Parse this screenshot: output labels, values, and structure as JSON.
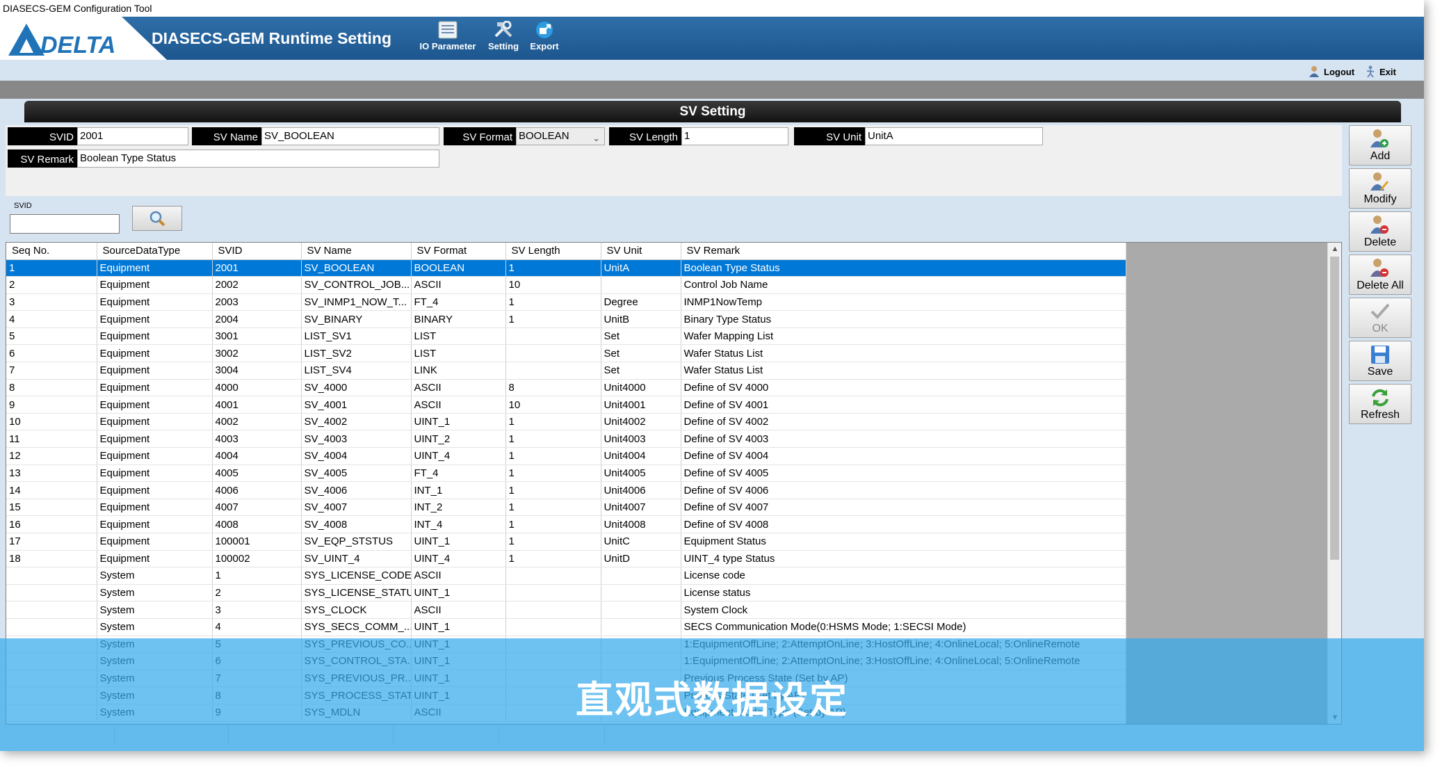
{
  "window": {
    "title": "DIASECS-GEM Configuration Tool"
  },
  "header": {
    "app_title": "DIASECS-GEM Runtime Setting",
    "logo_text": "DELTA",
    "toolbar": [
      {
        "label": "IO Parameter",
        "icon": "io-parameter-icon"
      },
      {
        "label": "Setting",
        "icon": "setting-tools-icon"
      },
      {
        "label": "Export",
        "icon": "export-icon"
      }
    ]
  },
  "top_actions": {
    "logout": "Logout",
    "exit": "Exit"
  },
  "section_title": "SV Setting",
  "form": {
    "svid": {
      "label": "SVID",
      "value": "2001"
    },
    "sv_name": {
      "label": "SV Name",
      "value": "SV_BOOLEAN"
    },
    "sv_format": {
      "label": "SV Format",
      "value": "BOOLEAN"
    },
    "sv_length": {
      "label": "SV Length",
      "value": "1"
    },
    "sv_unit": {
      "label": "SV Unit",
      "value": "UnitA"
    },
    "sv_remark": {
      "label": "SV Remark",
      "value": "Boolean Type Status"
    }
  },
  "search": {
    "label": "SVID",
    "value": ""
  },
  "table": {
    "columns": [
      "Seq No.",
      "SourceDataType",
      "SVID",
      "SV Name",
      "SV Format",
      "SV Length",
      "SV Unit",
      "SV Remark"
    ],
    "selected_row": 0,
    "rows": [
      [
        "1",
        "Equipment",
        "2001",
        "SV_BOOLEAN",
        "BOOLEAN",
        "1",
        "UnitA",
        "Boolean Type Status"
      ],
      [
        "2",
        "Equipment",
        "2002",
        "SV_CONTROL_JOB...",
        "ASCII",
        "10",
        "",
        "Control Job Name"
      ],
      [
        "3",
        "Equipment",
        "2003",
        "SV_INMP1_NOW_T...",
        "FT_4",
        "1",
        "Degree",
        "INMP1NowTemp"
      ],
      [
        "4",
        "Equipment",
        "2004",
        "SV_BINARY",
        "BINARY",
        "1",
        "UnitB",
        "Binary Type Status"
      ],
      [
        "5",
        "Equipment",
        "3001",
        "LIST_SV1",
        "LIST",
        "",
        "Set",
        "Wafer Mapping List"
      ],
      [
        "6",
        "Equipment",
        "3002",
        "LIST_SV2",
        "LIST",
        "",
        "Set",
        "Wafer Status List"
      ],
      [
        "7",
        "Equipment",
        "3004",
        "LIST_SV4",
        "LINK",
        "",
        "Set",
        "Wafer Status List"
      ],
      [
        "8",
        "Equipment",
        "4000",
        "SV_4000",
        "ASCII",
        "8",
        "Unit4000",
        "Define of SV 4000"
      ],
      [
        "9",
        "Equipment",
        "4001",
        "SV_4001",
        "ASCII",
        "10",
        "Unit4001",
        "Define of SV 4001"
      ],
      [
        "10",
        "Equipment",
        "4002",
        "SV_4002",
        "UINT_1",
        "1",
        "Unit4002",
        "Define of SV 4002"
      ],
      [
        "11",
        "Equipment",
        "4003",
        "SV_4003",
        "UINT_2",
        "1",
        "Unit4003",
        "Define of SV 4003"
      ],
      [
        "12",
        "Equipment",
        "4004",
        "SV_4004",
        "UINT_4",
        "1",
        "Unit4004",
        "Define of SV 4004"
      ],
      [
        "13",
        "Equipment",
        "4005",
        "SV_4005",
        "FT_4",
        "1",
        "Unit4005",
        "Define of SV 4005"
      ],
      [
        "14",
        "Equipment",
        "4006",
        "SV_4006",
        "INT_1",
        "1",
        "Unit4006",
        "Define of SV 4006"
      ],
      [
        "15",
        "Equipment",
        "4007",
        "SV_4007",
        "INT_2",
        "1",
        "Unit4007",
        "Define of SV 4007"
      ],
      [
        "16",
        "Equipment",
        "4008",
        "SV_4008",
        "INT_4",
        "1",
        "Unit4008",
        "Define of SV 4008"
      ],
      [
        "17",
        "Equipment",
        "100001",
        "SV_EQP_STSTUS",
        "UINT_1",
        "1",
        "UnitC",
        "Equipment Status"
      ],
      [
        "18",
        "Equipment",
        "100002",
        "SV_UINT_4",
        "UINT_4",
        "1",
        "UnitD",
        "UINT_4 type Status"
      ],
      [
        "",
        "System",
        "1",
        "SYS_LICENSE_CODE",
        "ASCII",
        "",
        "",
        "License code"
      ],
      [
        "",
        "System",
        "2",
        "SYS_LICENSE_STATUS",
        "UINT_1",
        "",
        "",
        "License status"
      ],
      [
        "",
        "System",
        "3",
        "SYS_CLOCK",
        "ASCII",
        "",
        "",
        "System Clock"
      ],
      [
        "",
        "System",
        "4",
        "SYS_SECS_COMM_...",
        "UINT_1",
        "",
        "",
        "SECS Communication Mode(0:HSMS Mode; 1:SECSI Mode)"
      ],
      [
        "",
        "System",
        "5",
        "SYS_PREVIOUS_CO...",
        "UINT_1",
        "",
        "",
        "1:EquipmentOffLine; 2:AttemptOnLine; 3:HostOffLine; 4:OnlineLocal; 5:OnlineRemote"
      ],
      [
        "",
        "System",
        "6",
        "SYS_CONTROL_STA...",
        "UINT_1",
        "",
        "",
        "1:EquipmentOffLine; 2:AttemptOnLine; 3:HostOffLine; 4:OnlineLocal; 5:OnlineRemote"
      ],
      [
        "",
        "System",
        "7",
        "SYS_PREVIOUS_PR...",
        "UINT_1",
        "",
        "",
        "Previous Process State (Set by AP)"
      ],
      [
        "",
        "System",
        "8",
        "SYS_PROCESS_STATE",
        "UINT_1",
        "",
        "",
        "Process State (Set by AP)"
      ],
      [
        "",
        "System",
        "9",
        "SYS_MDLN",
        "ASCII",
        "",
        "",
        "Equipment Model Type (Set by AP)"
      ]
    ]
  },
  "side_buttons": [
    {
      "label": "Add",
      "icon": "add-user-icon",
      "enabled": true
    },
    {
      "label": "Modify",
      "icon": "modify-user-icon",
      "enabled": true
    },
    {
      "label": "Delete",
      "icon": "delete-user-icon",
      "enabled": true
    },
    {
      "label": "Delete All",
      "icon": "delete-all-users-icon",
      "enabled": true
    },
    {
      "label": "OK",
      "icon": "checkmark-icon",
      "enabled": false
    },
    {
      "label": "Save",
      "icon": "save-disk-icon",
      "enabled": true
    },
    {
      "label": "Refresh",
      "icon": "refresh-icon",
      "enabled": true
    }
  ],
  "overlay_caption": "直观式数据设定",
  "colors": {
    "header_blue": "#1d568e",
    "selection_blue": "#0078d7",
    "overlay_blue": "#34aaec",
    "panel_bg": "#d6e3f1"
  }
}
